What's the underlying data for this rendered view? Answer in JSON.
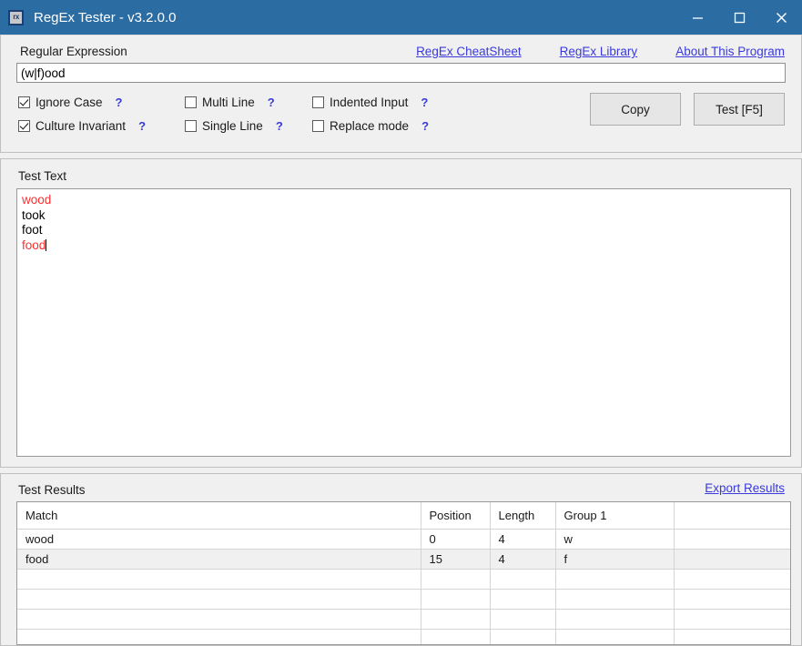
{
  "window": {
    "title": "RegEx Tester - v3.2.0.0",
    "icon": "rx-app-icon",
    "icon_text": "rx",
    "titlebar_color": "#2b6ca3",
    "controls": {
      "minimize": "minimize-icon",
      "maximize": "maximize-icon",
      "close": "close-icon"
    }
  },
  "regex_panel": {
    "label": "Regular Expression",
    "input_value": "(w|f)ood",
    "input_placeholder": "",
    "links": [
      {
        "label": "RegEx CheatSheet",
        "name": "regex-cheatsheet-link"
      },
      {
        "label": "RegEx Library",
        "name": "regex-library-link"
      },
      {
        "label": "About This Program",
        "name": "about-this-program-link"
      }
    ],
    "link_color": "#3a3adb",
    "options": [
      {
        "label": "Ignore Case",
        "checked": true,
        "help": "?"
      },
      {
        "label": "Multi Line",
        "checked": false,
        "help": "?"
      },
      {
        "label": "Indented Input",
        "checked": false,
        "help": "?"
      },
      {
        "label": "Culture Invariant",
        "checked": true,
        "help": "?"
      },
      {
        "label": "Single Line",
        "checked": false,
        "help": "?"
      },
      {
        "label": "Replace mode",
        "checked": false,
        "help": "?"
      }
    ],
    "buttons": {
      "copy": "Copy",
      "test": "Test [F5]"
    }
  },
  "test_text_panel": {
    "label": "Test Text",
    "match_color": "#ff2d2d",
    "lines": [
      {
        "text": "wood",
        "match": true
      },
      {
        "text": "took",
        "match": false
      },
      {
        "text": "foot",
        "match": false
      },
      {
        "text": "food",
        "match": true
      }
    ]
  },
  "results_panel": {
    "label": "Test Results",
    "export_link": "Export Results",
    "columns": [
      "Match",
      "Position",
      "Length",
      "Group 1",
      ""
    ],
    "rows": [
      [
        "wood",
        "0",
        "4",
        "w",
        ""
      ],
      [
        "food",
        "15",
        "4",
        "f",
        ""
      ]
    ],
    "empty_rows": 4
  }
}
